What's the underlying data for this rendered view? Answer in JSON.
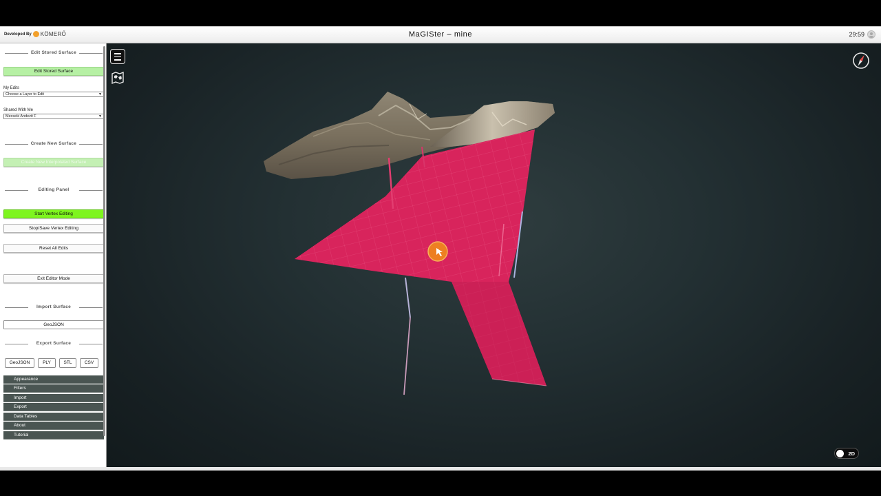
{
  "header": {
    "developed_by": "Developed By",
    "brand_name": "KÖMERŐ",
    "title": "MaGISter – mine",
    "clock": "29:59"
  },
  "sidebar": {
    "edit_stored": {
      "section_title": "Edit Stored Surface",
      "button_label": "Edit Stored Surface",
      "my_edits_label": "My Edits",
      "my_edits_value": "Choose a Layer to Edit",
      "shared_label": "Shared With Me",
      "shared_value": "Mecseki Andezit F"
    },
    "create_new": {
      "section_title": "Create New Surface",
      "button_label": "Create New Interpolated Surface"
    },
    "editing_panel": {
      "section_title": "Editing Panel",
      "start_label": "Start Vertex Editing",
      "stop_label": "Stop/Save Vertex Editing",
      "reset_label": "Reset All Edits",
      "exit_label": "Exit Editor Mode"
    },
    "import_surface": {
      "section_title": "Import Surface",
      "geojson_label": "GeoJSON"
    },
    "export_surface": {
      "section_title": "Export Surface",
      "buttons": [
        "GeoJSON",
        "PLY",
        "STL",
        "CSV"
      ]
    },
    "menu": [
      "Appearance",
      "Filters",
      "Import",
      "Export",
      "Data Tables",
      "About",
      "Tutorial"
    ]
  },
  "viewport": {
    "toggle_label": "2D",
    "surface_color": "#d8245c",
    "cursor_color": "#f08a1c"
  }
}
